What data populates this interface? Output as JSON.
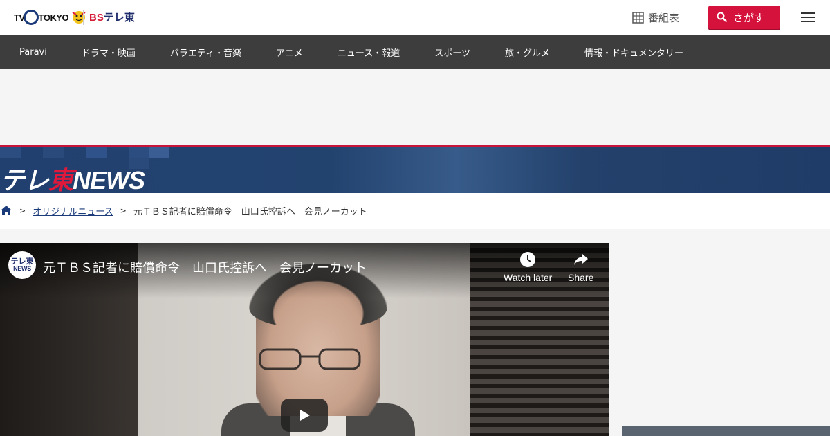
{
  "header": {
    "logo_tv": "TV",
    "logo_tokyo": "TOKYO",
    "logo_bs_prefix": "BS",
    "logo_bs_suffix": "テレ東",
    "bangumi_label": "番組表",
    "search_label": "さがす"
  },
  "nav": {
    "items": [
      "Paravi",
      "ドラマ・映画",
      "バラエティ・音楽",
      "アニメ",
      "ニュース・報道",
      "スポーツ",
      "旅・グルメ",
      "情報・ドキュメンタリー"
    ]
  },
  "banner": {
    "logo_part1": "テレ",
    "logo_part2": "東",
    "logo_part3": "NEWS"
  },
  "breadcrumb": {
    "sep": ">",
    "category": "オリジナルニュース",
    "current": "元ＴＢＳ記者に賠償命令　山口氏控訴へ　会見ノーカット"
  },
  "video": {
    "channel_top": "テレ東",
    "channel_bottom": "NEWS",
    "title": "元ＴＢＳ記者に賠償命令　山口氏控訴へ　会見ノーカット",
    "watch_later": "Watch later",
    "share": "Share"
  },
  "colors": {
    "brand_red": "#d4123c",
    "nav_bg": "#3d3d3d",
    "banner_blue": "#21406f"
  }
}
